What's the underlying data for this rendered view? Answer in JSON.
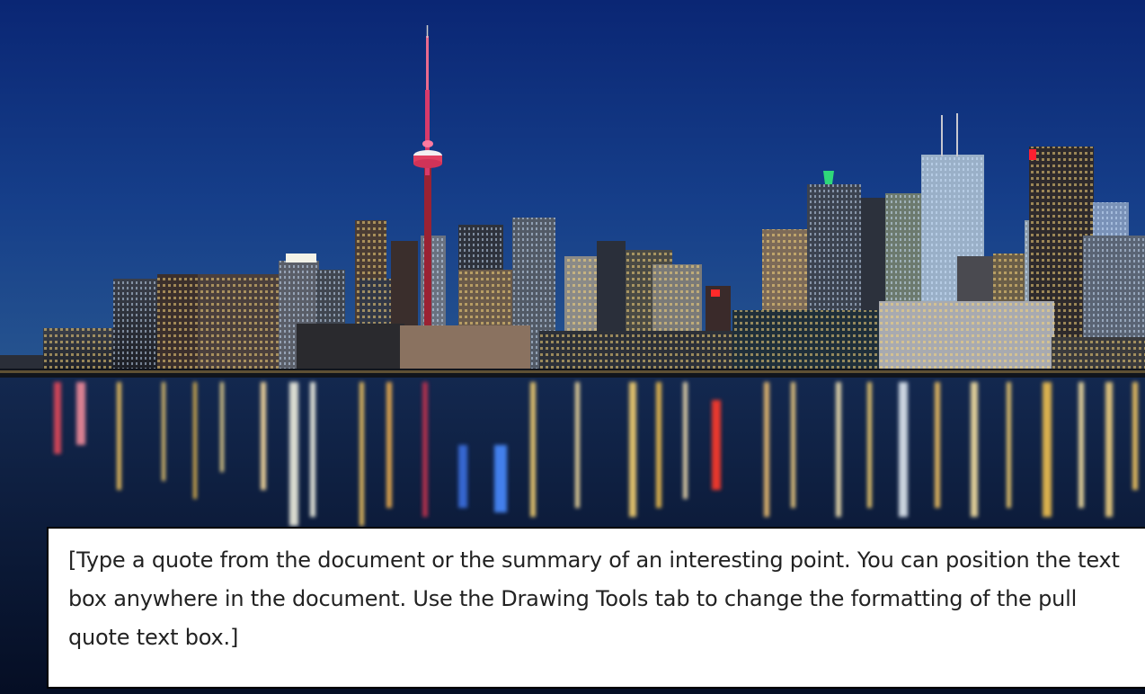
{
  "pull_quote": {
    "text": "[Type a quote from the document or the summary of an interesting point. You can position the text box anywhere in the document. Use the Drawing Tools tab to change the formatting of the pull quote text box.]"
  },
  "colors": {
    "sky_top": "#0b2a78",
    "sky_bottom": "#1d4a8c",
    "water": "#0a1a3a",
    "tower_light": "#ff3a6e",
    "box_border": "#000000"
  },
  "icons": [
    "cn-tower-image",
    "city-skyline-image"
  ]
}
